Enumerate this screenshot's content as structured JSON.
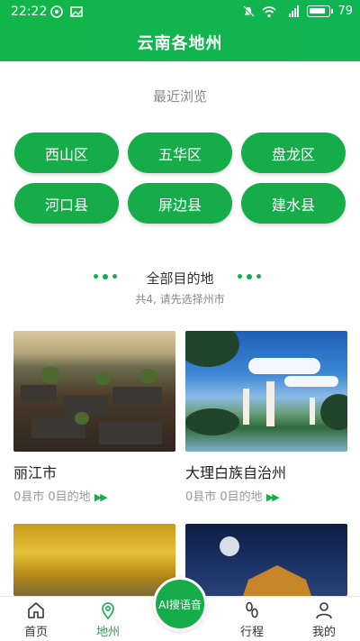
{
  "status": {
    "time": "22:22",
    "battery": "79"
  },
  "header": {
    "title": "云南各地州"
  },
  "recent": {
    "title": "最近浏览",
    "items": [
      "西山区",
      "五华区",
      "盘龙区",
      "河口县",
      "屏边县",
      "建水县"
    ]
  },
  "all": {
    "title": "全部目的地",
    "subtitle": "共4, 请先选择州市"
  },
  "cards": [
    {
      "name": "丽江市",
      "meta": "0县市 0目的地"
    },
    {
      "name": "大理白族自治州",
      "meta": "0县市 0目的地"
    }
  ],
  "nav": {
    "home": "首页",
    "region": "地州",
    "voice": "AI搜语音",
    "trip": "行程",
    "mine": "我的"
  },
  "colors": {
    "accent": "#17ac4a",
    "header": "#12b548"
  }
}
